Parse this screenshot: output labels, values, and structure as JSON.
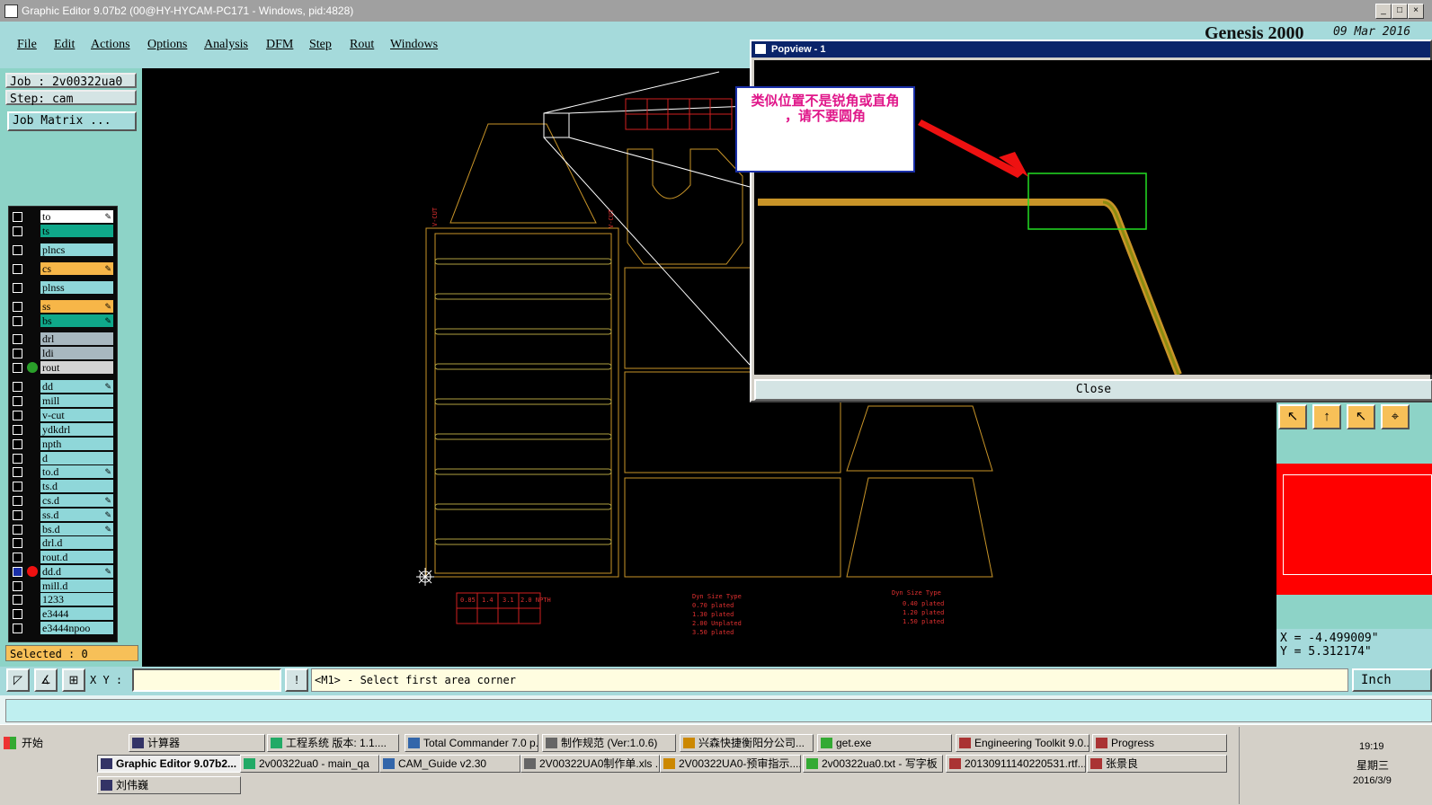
{
  "window": {
    "title": "Graphic Editor 9.07b2 (00@HY-HYCAM-PC171 - Windows, pid:4828)"
  },
  "menu": {
    "items": [
      "File",
      "Edit",
      "Actions",
      "Options",
      "Analysis",
      "DFM",
      "Step",
      "Rout",
      "Windows"
    ]
  },
  "logo": {
    "title": "Genesis 2000",
    "date": "09 Mar 2016"
  },
  "job": {
    "job_label": "Job : 2v00322ua0",
    "step_label": "Step: cam",
    "matrix_button": "Job Matrix ..."
  },
  "layers": [
    {
      "name": "to",
      "color": "#ffffff",
      "edit": true
    },
    {
      "name": "ts",
      "color": "#0fa88a",
      "edit": false
    },
    {
      "name": "plncs",
      "color": "#8fd7d9",
      "edit": false
    },
    {
      "name": "cs",
      "color": "#f7b648",
      "edit": true
    },
    {
      "name": "plnss",
      "color": "#8fd7d9",
      "edit": false
    },
    {
      "name": "ss",
      "color": "#f7b648",
      "edit": true
    },
    {
      "name": "bs",
      "color": "#0fa88a",
      "edit": true
    },
    {
      "name": "drl",
      "color": "#a8b8c0",
      "edit": false
    },
    {
      "name": "ldi",
      "color": "#a8b8c0",
      "edit": false
    },
    {
      "name": "rout",
      "color": "#d4d4d4",
      "edit": false,
      "dot": "#2aa02a"
    },
    {
      "name": "dd",
      "color": "#8fd7d9",
      "edit": true
    },
    {
      "name": "mill",
      "color": "#8fd7d9",
      "edit": false
    },
    {
      "name": "v-cut",
      "color": "#8fd7d9",
      "edit": false
    },
    {
      "name": "ydkdrl",
      "color": "#8fd7d9",
      "edit": false
    },
    {
      "name": "npth",
      "color": "#8fd7d9",
      "edit": false
    },
    {
      "name": "d",
      "color": "#8fd7d9",
      "edit": false
    },
    {
      "name": "to.d",
      "color": "#8fd7d9",
      "edit": true
    },
    {
      "name": "ts.d",
      "color": "#8fd7d9",
      "edit": false
    },
    {
      "name": "cs.d",
      "color": "#8fd7d9",
      "edit": true
    },
    {
      "name": "ss.d",
      "color": "#8fd7d9",
      "edit": true
    },
    {
      "name": "bs.d",
      "color": "#8fd7d9",
      "edit": true
    },
    {
      "name": "drl.d",
      "color": "#8fd7d9",
      "edit": false
    },
    {
      "name": "rout.d",
      "color": "#8fd7d9",
      "edit": false
    },
    {
      "name": "dd.d",
      "color": "#8fd7d9",
      "edit": true,
      "dot": "#ee1111",
      "selected": true
    },
    {
      "name": "mill.d",
      "color": "#8fd7d9",
      "edit": false
    },
    {
      "name": "1233",
      "color": "#8fd7d9",
      "edit": false
    },
    {
      "name": "e3444",
      "color": "#8fd7d9",
      "edit": false
    },
    {
      "name": "e3444npoo",
      "color": "#8fd7d9",
      "edit": false
    }
  ],
  "selected": "Selected : 0",
  "canvas": {
    "table1": [
      "0.85",
      "1.4",
      "3.1",
      "2.0 NPTH"
    ],
    "legend_header": "Dyn Size  Type",
    "legend_rows": [
      "0.70  plated",
      "1.30  plated",
      "2.00  Unplated",
      "3.50  plated"
    ],
    "legend2_header": "Dyn Size  Type",
    "legend2_rows": [
      "0.40  plated",
      "1.20  plated",
      "1.50  plated"
    ],
    "vcut_label": "V-CUT"
  },
  "popview": {
    "title": "Popview - 1",
    "close_label": "Close"
  },
  "annotation": {
    "line1": "类似位置不是锐角或直角",
    "line2": "，请不要圆角"
  },
  "coords": {
    "x": "X = -4.499009\"",
    "y": "Y = 5.312174\""
  },
  "command": {
    "xy_label": "X Y :",
    "prompt": "<M1> - Select first area corner",
    "units": "Inch"
  },
  "taskbar": {
    "start": "开始",
    "row1": [
      "计算器",
      "工程系统  版本: 1.1....",
      "Total Commander 7.0 p...",
      "制作规范 (Ver:1.0.6)",
      "兴森快捷衡阳分公司...",
      "get.exe",
      "Engineering Toolkit 9.0...",
      "Progress"
    ],
    "row2": [
      "Graphic Editor 9.07b2...",
      "2v00322ua0 - main_qa",
      "CAM_Guide v2.30",
      "2V00322UA0制作单.xls ...",
      "2V00322UA0-预审指示....",
      "2v00322ua0.txt - 写字板",
      "20130911140220531.rtf...",
      "张景良"
    ],
    "row3": [
      "刘伟巍"
    ],
    "time": "19:19",
    "day": "星期三",
    "date": "2016/3/9"
  }
}
